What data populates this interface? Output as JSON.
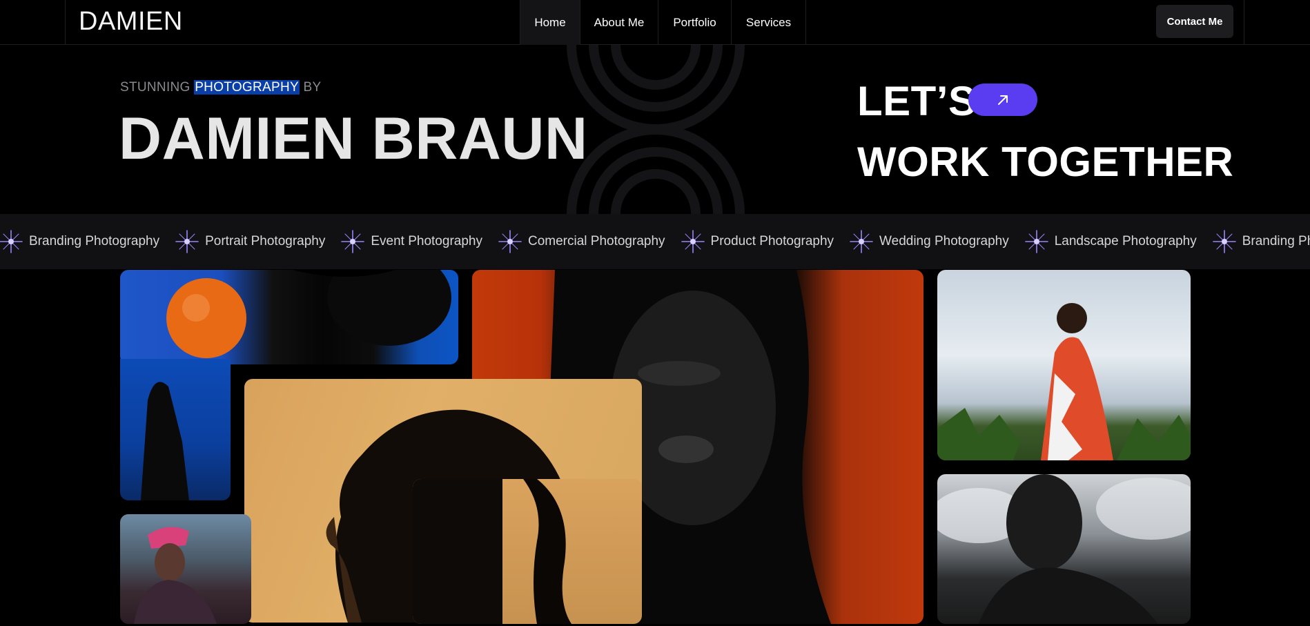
{
  "nav": {
    "logo": "DAMIEN",
    "items": [
      {
        "label": "Home",
        "active": true
      },
      {
        "label": "About Me",
        "active": false
      },
      {
        "label": "Portfolio",
        "active": false
      },
      {
        "label": "Services",
        "active": false
      }
    ],
    "contact_label": "Contact Me"
  },
  "hero": {
    "eyebrow_before": "STUNNING ",
    "eyebrow_selected": "PHOTOGRAPHY",
    "eyebrow_after": " BY",
    "name": "DAMIEN BRAUN",
    "cta_line1": "LET’S",
    "cta_line2": "WORK TOGETHER",
    "cta_icon": "arrow-up-right-icon"
  },
  "marquee": {
    "icon": "sparkle-star-icon",
    "items": [
      "Branding Photography",
      "Portrait Photography",
      "Event Photography",
      "Comercial Photography",
      "Product Photography",
      "Wedding Photography",
      "Landscape Photography",
      "Branding Photography"
    ]
  },
  "gallery": {
    "photos": [
      "orange-hand-portrait",
      "red-background-man-portrait",
      "braided-hair-profile-portrait",
      "field-woman-portrait",
      "sky-man-portrait",
      "pink-headscarf-portrait"
    ]
  },
  "colors": {
    "background": "#000000",
    "accent": "#5a3df0",
    "selection": "#0b3fa8",
    "marquee_bg": "#111113",
    "star": "#9b86ff"
  }
}
